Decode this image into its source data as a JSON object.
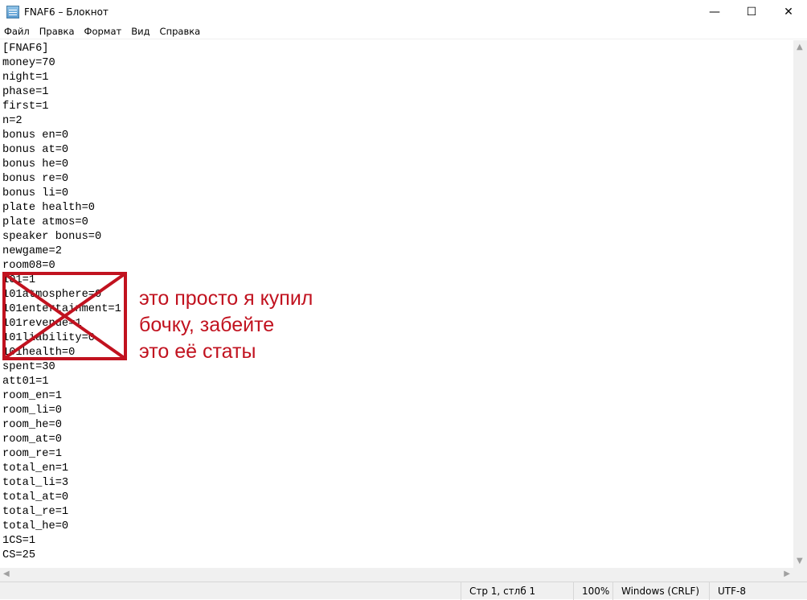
{
  "window": {
    "title": "FNAF6 – Блокнот",
    "minimize": "—",
    "maximize": "☐",
    "close": "✕"
  },
  "menu": [
    "Файл",
    "Правка",
    "Формат",
    "Вид",
    "Справка"
  ],
  "lines": [
    "[FNAF6]",
    "money=70",
    "night=1",
    "phase=1",
    "first=1",
    "n=2",
    "bonus en=0",
    "bonus at=0",
    "bonus he=0",
    "bonus re=0",
    "bonus li=0",
    "plate health=0",
    "plate atmos=0",
    "speaker bonus=0",
    "newgame=2",
    "room08=0",
    "101=1",
    "101atmosphere=0",
    "101entertainment=1",
    "101revenue=1",
    "101liability=0",
    "101health=0",
    "spent=30",
    "att01=1",
    "room_en=1",
    "room_li=0",
    "room_he=0",
    "room_at=0",
    "room_re=1",
    "total_en=1",
    "total_li=3",
    "total_at=0",
    "total_re=1",
    "total_he=0",
    "1CS=1",
    "CS=25"
  ],
  "annotation": {
    "lines": [
      "это просто я купил",
      "бочку, забейте",
      "это её статы"
    ],
    "color": "#c1121f"
  },
  "status": {
    "position": "Стр 1, стлб 1",
    "zoom": "100%",
    "line_ending": "Windows (CRLF)",
    "encoding": "UTF-8"
  }
}
